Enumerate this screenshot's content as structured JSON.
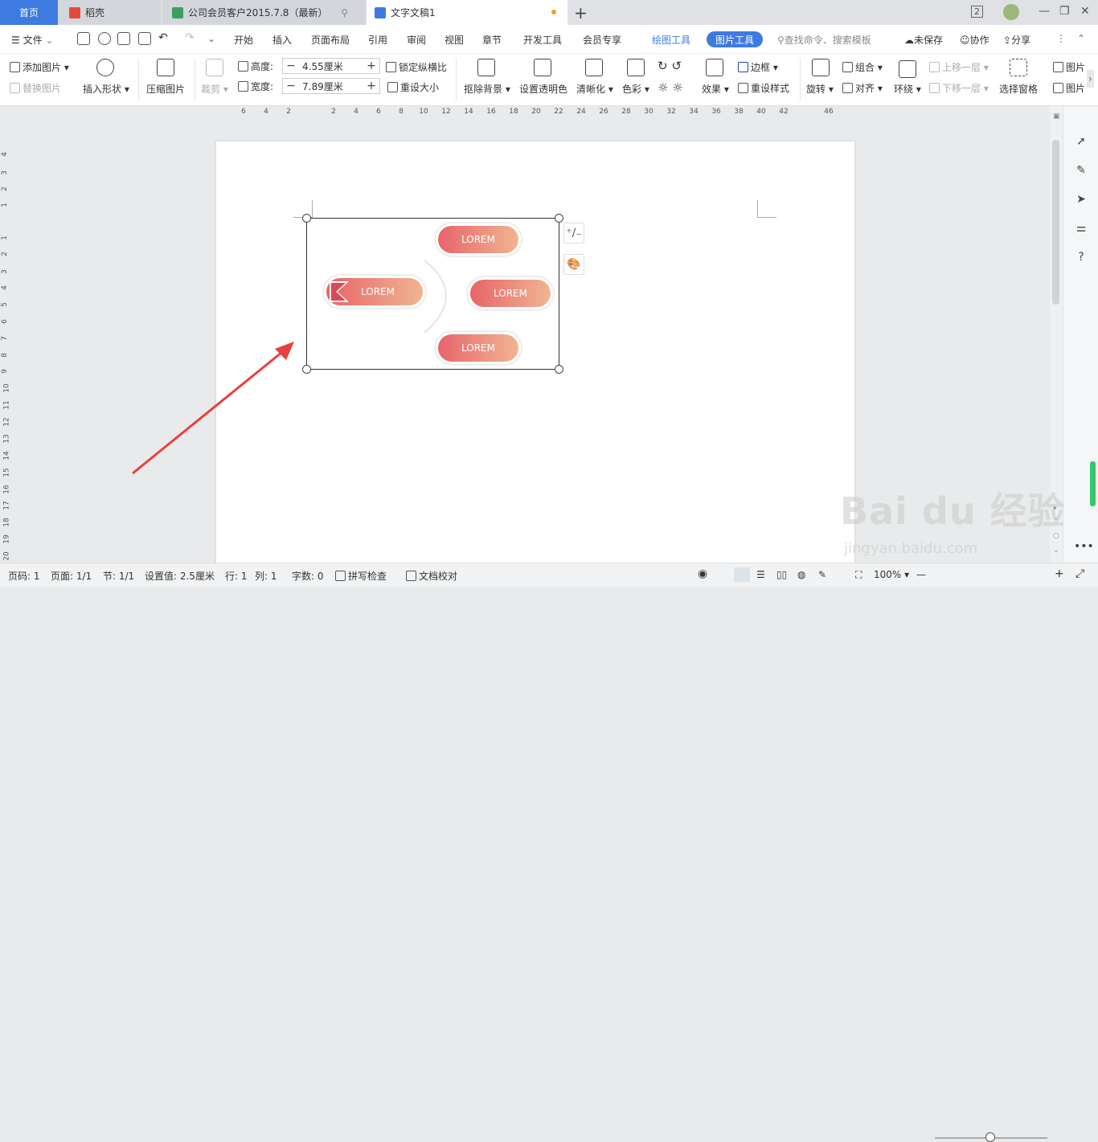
{
  "tabs": {
    "home": "首页",
    "daoke": "稻壳",
    "sheet": "公司会员客户2015.7.8（最新）",
    "doc": "文字文稿1",
    "badge": "2"
  },
  "menu": {
    "file": "文件",
    "items": [
      "开始",
      "插入",
      "页面布局",
      "引用",
      "审阅",
      "视图",
      "章节",
      "开发工具",
      "会员专享"
    ],
    "draw_tool": "绘图工具",
    "pic_tool": "图片工具",
    "search": "查找命令、搜索模板",
    "unsaved": "未保存",
    "collab": "协作",
    "share": "分享"
  },
  "ribbon": {
    "add_pic": "添加图片",
    "replace_pic": "替换图片",
    "insert_shape": "插入形状",
    "compress": "压缩图片",
    "crop": "裁剪",
    "height_label": "高度:",
    "height_value": "4.55厘米",
    "width_label": "宽度:",
    "width_value": "7.89厘米",
    "lock_ratio": "锁定纵横比",
    "reset_size": "重设大小",
    "remove_bg": "抠除背景",
    "set_transparent": "设置透明色",
    "sharpen": "清晰化",
    "color": "色彩",
    "effect": "效果",
    "border": "边框",
    "reset_style": "重设样式",
    "rotate": "旋转",
    "group": "组合",
    "align": "对齐",
    "wrap": "环绕",
    "up_layer": "上移一层",
    "down_layer": "下移一层",
    "select_pane": "选择窗格",
    "pic_a": "图片",
    "pic_b": "图片"
  },
  "ruler": {
    "h": [
      "6",
      "4",
      "2",
      "2",
      "4",
      "6",
      "8",
      "10",
      "12",
      "14",
      "16",
      "18",
      "20",
      "22",
      "24",
      "26",
      "28",
      "30",
      "32",
      "34",
      "36",
      "38",
      "40",
      "42",
      "46"
    ],
    "v": [
      "4",
      "3",
      "2",
      "1",
      "1",
      "2",
      "3",
      "4",
      "5",
      "6",
      "7",
      "8",
      "9",
      "10",
      "11",
      "12",
      "13",
      "14",
      "15",
      "16",
      "17",
      "18",
      "19",
      "20"
    ]
  },
  "graphic": {
    "labels": [
      "LOREM",
      "LOREM",
      "LOREM",
      "LOREM"
    ]
  },
  "status": {
    "page_code": "页码: 1",
    "pages": "页面: 1/1",
    "section": "节: 1/1",
    "setting": "设置值: 2.5厘米",
    "row": "行: 1",
    "col": "列: 1",
    "words": "字数: 0",
    "spell": "拼写检查",
    "proof": "文档校对",
    "zoom": "100%"
  },
  "watermark": {
    "brand": "Bai du 经验",
    "url": "jingyan.baidu.com"
  },
  "colors": {
    "accent": "#3e7be0",
    "pill_start": "#e8646a",
    "pill_end": "#f0b592",
    "arrow": "#e8403c"
  }
}
